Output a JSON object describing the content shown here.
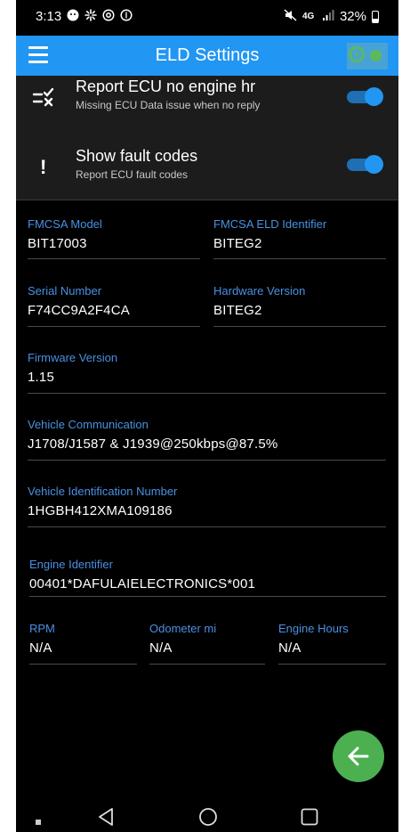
{
  "status_bar": {
    "time": "3:13",
    "battery": "32%",
    "left_icons": [
      "bitmoji-icon",
      "sparkle-icon",
      "at-icon",
      "dollar-icon"
    ],
    "right_icons": [
      "mute-icon",
      "4g-icon",
      "signal-icon",
      "battery-icon"
    ]
  },
  "app_bar": {
    "title": "ELD Settings",
    "menu_icon": "hamburger-icon",
    "connection_icon": "connection-status-icon"
  },
  "settings": [
    {
      "icon": "ecu-toggle-icon",
      "title": "Report ECU no engine hr",
      "subtitle": "Missing ECU Data issue when no reply",
      "enabled": true
    },
    {
      "icon": "exclamation-icon",
      "icon_glyph": "!",
      "title": "Show fault codes",
      "subtitle": "Report ECU fault codes",
      "enabled": true
    }
  ],
  "fields": {
    "fmcsa_model": {
      "label": "FMCSA Model",
      "value": "BIT17003"
    },
    "fmcsa_eld_id": {
      "label": "FMCSA ELD Identifier",
      "value": "BITEG2"
    },
    "serial_number": {
      "label": "Serial Number",
      "value": "F74CC9A2F4CA"
    },
    "hardware_version": {
      "label": "Hardware Version",
      "value": "BITEG2"
    },
    "firmware_version": {
      "label": "Firmware Version",
      "value": "1.15"
    },
    "vehicle_comm": {
      "label": "Vehicle Communication",
      "value": "J1708/J1587 & J1939@250kbps@87.5%"
    },
    "vin": {
      "label": "Vehicle Identification Number",
      "value": "1HGBH412XMA109186"
    },
    "engine_id": {
      "label": "Engine Identifier",
      "value": "00401*DAFULAIELECTRONICS*001"
    },
    "rpm": {
      "label": "RPM",
      "value": "N/A"
    },
    "odometer": {
      "label": "Odometer mi",
      "value": "N/A"
    },
    "engine_hours": {
      "label": "Engine Hours",
      "value": "N/A"
    }
  },
  "fab": {
    "icon": "arrow-left-icon"
  },
  "nav_bar": {
    "icons": [
      "recent-apps-icon",
      "back-icon",
      "home-icon",
      "overview-icon"
    ]
  },
  "colors": {
    "app_bar": "#2196f3",
    "label_blue": "#4a90e2",
    "toggle_on": "#2196f3",
    "fab_green": "#4caf50",
    "background": "#000000"
  }
}
